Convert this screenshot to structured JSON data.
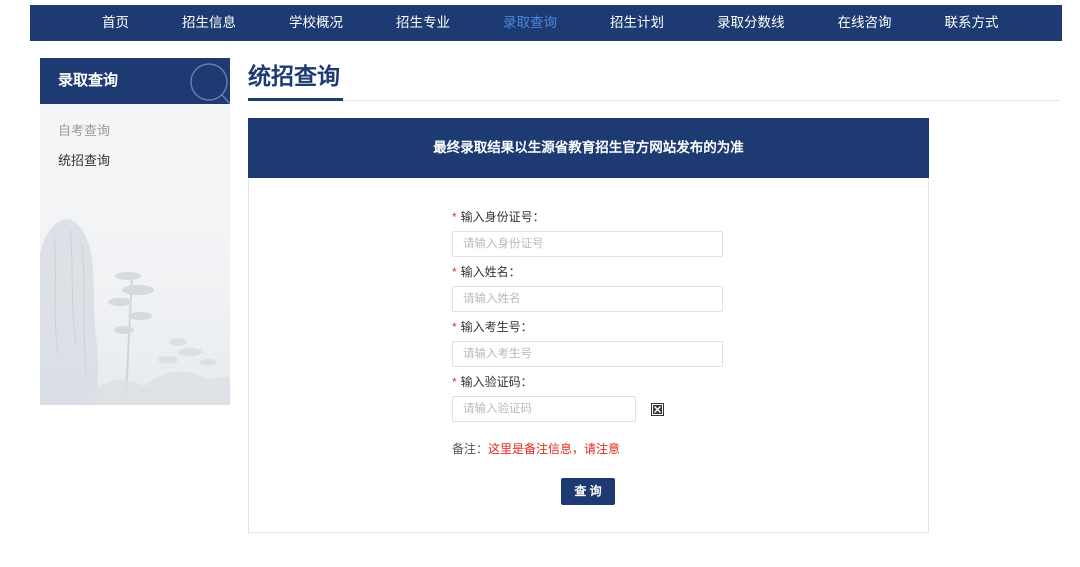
{
  "colors": {
    "primary": "#1d3b72",
    "nav_active": "#4d85d6",
    "required": "#e0322a",
    "note": "#e02a20"
  },
  "icons": {
    "sidebar_search": "search-icon",
    "captcha_image": "broken-image-icon"
  },
  "nav": {
    "items": [
      {
        "label": "首页",
        "active": false
      },
      {
        "label": "招生信息",
        "active": false
      },
      {
        "label": "学校概况",
        "active": false
      },
      {
        "label": "招生专业",
        "active": false
      },
      {
        "label": "录取查询",
        "active": true
      },
      {
        "label": "招生计划",
        "active": false
      },
      {
        "label": "录取分数线",
        "active": false
      },
      {
        "label": "在线咨询",
        "active": false
      },
      {
        "label": "联系方式",
        "active": false
      }
    ]
  },
  "sidebar": {
    "title": "录取查询",
    "items": [
      {
        "label": "自考查询",
        "active": false
      },
      {
        "label": "统招查询",
        "active": true
      }
    ]
  },
  "main": {
    "title": "统招查询",
    "notice": "最终录取结果以生源省教育招生官方网站发布的为准",
    "form": {
      "required_mark": "*",
      "fields": [
        {
          "label": "输入身份证号：",
          "placeholder": "请输入身份证号",
          "value": ""
        },
        {
          "label": "输入姓名：",
          "placeholder": "请输入姓名",
          "value": ""
        },
        {
          "label": "输入考生号：",
          "placeholder": "请输入考生号",
          "value": ""
        },
        {
          "label": "输入验证码：",
          "placeholder": "请输入验证码",
          "value": ""
        }
      ],
      "note_label": "备注：",
      "note_text": "这里是备注信息，请注意",
      "submit_label": "查 询"
    }
  }
}
